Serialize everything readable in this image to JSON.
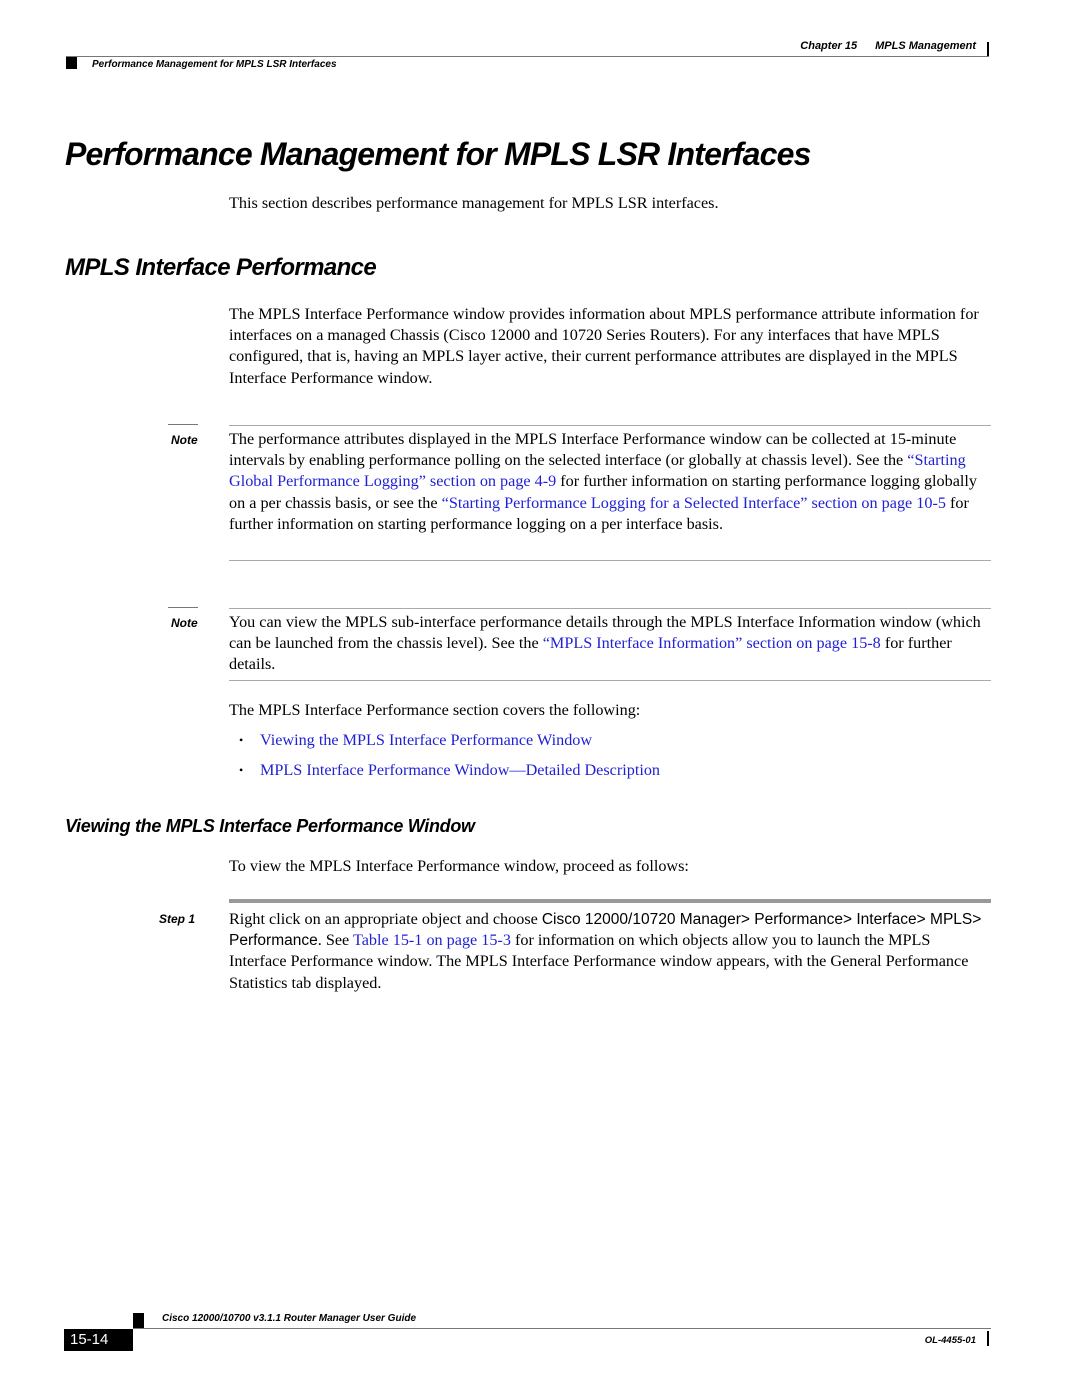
{
  "header": {
    "chapter_label": "Chapter 15",
    "chapter_title": "MPLS Management",
    "section_title": "Performance Management for MPLS LSR Interfaces"
  },
  "title": "Performance Management for MPLS LSR Interfaces",
  "intro": "This section describes performance management for MPLS LSR interfaces.",
  "section": {
    "heading": "MPLS Interface Performance",
    "paragraph": "The MPLS Interface Performance window provides information about MPLS performance attribute information for interfaces on a managed Chassis (Cisco 12000 and 10720 Series Routers). For any interfaces that have MPLS configured, that is, having an MPLS layer active, their current performance attributes are displayed in the MPLS Interface Performance window."
  },
  "note1": {
    "label": "Note",
    "text_a": "The performance attributes displayed in the MPLS Interface Performance window can be collected at 15-minute intervals by enabling performance polling on the selected interface (or globally at chassis level). See the ",
    "link_a": "“Starting Global Performance Logging” section on page 4-9",
    "text_b": " for further information on starting performance logging globally on a per chassis basis, or see the ",
    "link_b": "“Starting Performance Logging for a Selected Interface” section on page 10-5",
    "text_c": " for further information on starting performance logging on a per interface basis."
  },
  "note2": {
    "label": "Note",
    "text_a": "You can view the MPLS sub-interface performance details through the MPLS Interface Information window (which can be launched from the chassis level). See the ",
    "link_a": "“MPLS Interface Information” section on page 15-8",
    "text_b": " for further details."
  },
  "covers_intro": "The MPLS Interface Performance section covers the following:",
  "covers_list": [
    "Viewing the MPLS Interface Performance Window",
    "MPLS Interface Performance Window—Detailed Description"
  ],
  "subsection": {
    "heading": "Viewing the MPLS Interface Performance Window",
    "intro": "To view the MPLS Interface Performance window, proceed as follows:"
  },
  "step1": {
    "label": "Step 1",
    "text_a": "Right click on an appropriate object and choose ",
    "menu_path": "Cisco 12000/10720 Manager> Performance> Interface> MPLS> Performance",
    "text_b": ". See ",
    "link": "Table 15-1 on page 15-3",
    "text_c": " for information on which objects allow you to launch the MPLS Interface Performance window. The MPLS Interface Performance window appears, with the General Performance Statistics tab displayed."
  },
  "footer": {
    "guide_title": "Cisco 12000/10700 v3.1.1 Router Manager User Guide",
    "page_number": "15-14",
    "doc_number": "OL-4455-01"
  }
}
